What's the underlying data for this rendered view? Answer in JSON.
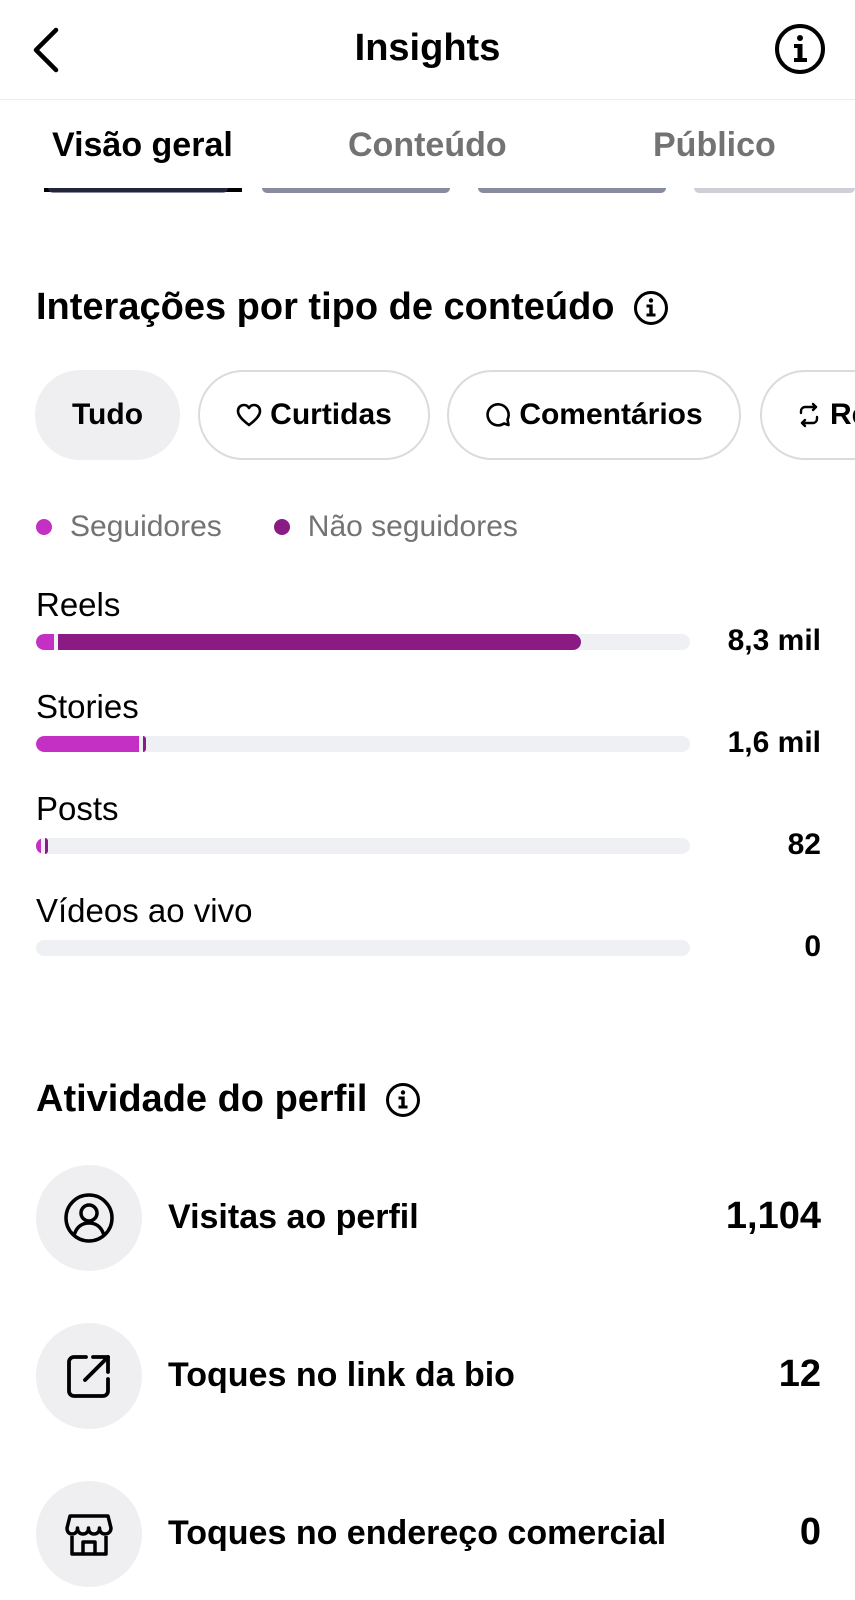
{
  "header": {
    "title": "Insights",
    "back_icon": "chevron-left-icon",
    "info_icon": "info-circle-icon"
  },
  "tabs": [
    {
      "label": "Visão geral",
      "active": true
    },
    {
      "label": "Conteúdo",
      "active": false
    },
    {
      "label": "Público",
      "active": false
    }
  ],
  "interactions": {
    "title": "Interações por tipo de conteúdo",
    "chips": [
      {
        "label": "Tudo",
        "icon": "",
        "selected": true
      },
      {
        "label": "Curtidas",
        "icon": "heart-icon",
        "selected": false
      },
      {
        "label": "Comentários",
        "icon": "comment-icon",
        "selected": false
      },
      {
        "label": "Re",
        "icon": "repost-icon",
        "selected": false
      }
    ],
    "legend": [
      {
        "label": "Seguidores",
        "color": "#c42fc4"
      },
      {
        "label": "Não seguidores",
        "color": "#8a1b84"
      }
    ],
    "rows": [
      {
        "label": "Reels",
        "value": "8,3 mil",
        "followers_fraction": 0.028,
        "non_followers_fraction": 0.8
      },
      {
        "label": "Stories",
        "value": "1,6 mil",
        "followers_fraction": 0.157,
        "non_followers_fraction": 0.004
      },
      {
        "label": "Posts",
        "value": "82",
        "followers_fraction": 0.008,
        "non_followers_fraction": 0.004
      },
      {
        "label": "Vídeos ao vivo",
        "value": "0",
        "followers_fraction": 0,
        "non_followers_fraction": 0
      }
    ]
  },
  "profile_activity": {
    "title": "Atividade do perfil",
    "rows": [
      {
        "label": "Visitas ao perfil",
        "value": "1,104",
        "icon": "user-circle-icon"
      },
      {
        "label": "Toques no link da bio",
        "value": "12",
        "icon": "external-link-icon"
      },
      {
        "label": "Toques no endereço comercial",
        "value": "0",
        "icon": "storefront-icon"
      }
    ]
  },
  "colors": {
    "followers": "#c42fc4",
    "non_followers": "#8a1b84",
    "track": "#eff0f4",
    "muted_text": "#737373"
  }
}
